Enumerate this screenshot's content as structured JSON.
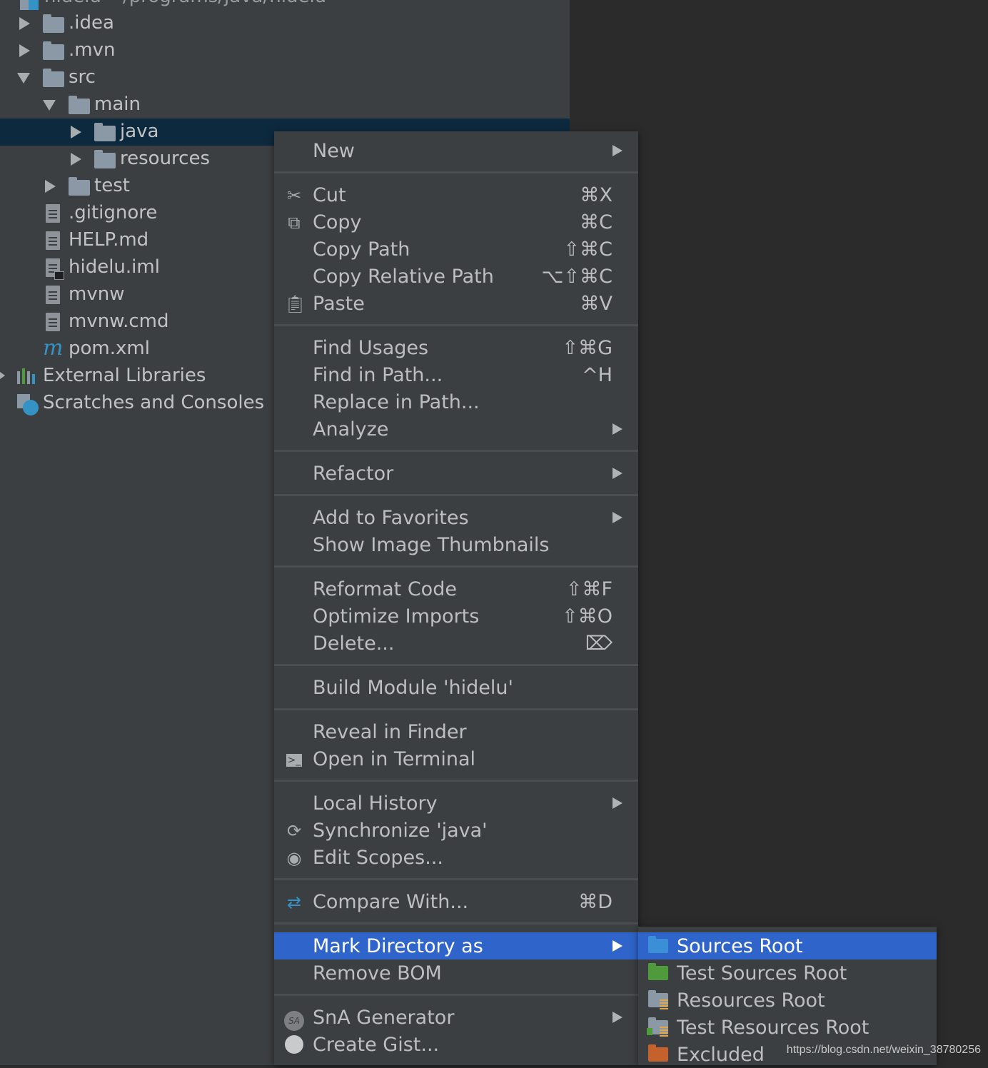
{
  "project_tree": {
    "root_partial": "hidelu  ~/programs/java/hidelu",
    "items": [
      {
        "label": ".idea",
        "kind": "folder",
        "state": "collapsed"
      },
      {
        "label": ".mvn",
        "kind": "folder",
        "state": "collapsed"
      },
      {
        "label": "src",
        "kind": "folder",
        "state": "expanded"
      },
      {
        "label": "main",
        "kind": "folder",
        "state": "expanded"
      },
      {
        "label": "java",
        "kind": "folder",
        "state": "collapsed",
        "selected": true
      },
      {
        "label": "resources",
        "kind": "folder",
        "state": "collapsed"
      },
      {
        "label": "test",
        "kind": "folder",
        "state": "collapsed"
      },
      {
        "label": ".gitignore",
        "kind": "file"
      },
      {
        "label": "HELP.md",
        "kind": "file"
      },
      {
        "label": "hidelu.iml",
        "kind": "file"
      },
      {
        "label": "mvnw",
        "kind": "file"
      },
      {
        "label": "mvnw.cmd",
        "kind": "file"
      },
      {
        "label": "pom.xml",
        "kind": "maven-file"
      },
      {
        "label": "External Libraries",
        "kind": "libraries"
      },
      {
        "label": "Scratches and Consoles",
        "kind": "scratches"
      }
    ]
  },
  "context_menu": {
    "items": [
      {
        "label": "New",
        "submenu": true
      },
      {
        "label": "Cut",
        "shortcut": "⌘X",
        "icon": "scissors-icon"
      },
      {
        "label": "Copy",
        "shortcut": "⌘C",
        "icon": "copy-icon"
      },
      {
        "label": "Copy Path",
        "shortcut": "⇧⌘C"
      },
      {
        "label": "Copy Relative Path",
        "shortcut": "⌥⇧⌘C"
      },
      {
        "label": "Paste",
        "shortcut": "⌘V",
        "icon": "paste-icon"
      },
      {
        "label": "Find Usages",
        "shortcut": "⇧⌘G"
      },
      {
        "label": "Find in Path...",
        "shortcut": "^H"
      },
      {
        "label": "Replace in Path..."
      },
      {
        "label": "Analyze",
        "submenu": true
      },
      {
        "label": "Refactor",
        "submenu": true
      },
      {
        "label": "Add to Favorites",
        "submenu": true
      },
      {
        "label": "Show Image Thumbnails"
      },
      {
        "label": "Reformat Code",
        "shortcut": "⇧⌘F"
      },
      {
        "label": "Optimize Imports",
        "shortcut": "⇧⌘O"
      },
      {
        "label": "Delete...",
        "shortcut": "⌦"
      },
      {
        "label": "Build Module 'hidelu'"
      },
      {
        "label": "Reveal in Finder"
      },
      {
        "label": "Open in Terminal",
        "icon": "terminal-icon"
      },
      {
        "label": "Local History",
        "submenu": true
      },
      {
        "label": "Synchronize 'java'",
        "icon": "sync-icon"
      },
      {
        "label": "Edit Scopes...",
        "icon": "scope-icon"
      },
      {
        "label": "Compare With...",
        "shortcut": "⌘D",
        "icon": "compare-icon"
      },
      {
        "label": "Mark Directory as",
        "submenu": true,
        "active": true
      },
      {
        "label": "Remove BOM"
      },
      {
        "label": "SnA Generator",
        "submenu": true,
        "icon": "sna-icon"
      },
      {
        "label": "Create Gist...",
        "icon": "github-icon"
      }
    ]
  },
  "mark_directory_submenu": {
    "items": [
      {
        "label": "Sources Root",
        "color": "#3b8fd6",
        "active": true
      },
      {
        "label": "Test Sources Root",
        "color": "#4f9a3a"
      },
      {
        "label": "Resources Root",
        "color": "#8b98a5"
      },
      {
        "label": "Test Resources Root",
        "color": "#8b98a5"
      },
      {
        "label": "Excluded",
        "color": "#c4612d"
      }
    ]
  },
  "watermark": "https://blog.csdn.net/weixin_38780256",
  "colors": {
    "selection": "#2f65ca",
    "tree_selection": "#0d293e",
    "panel": "#3c3f41",
    "editor": "#2b2b2b"
  }
}
